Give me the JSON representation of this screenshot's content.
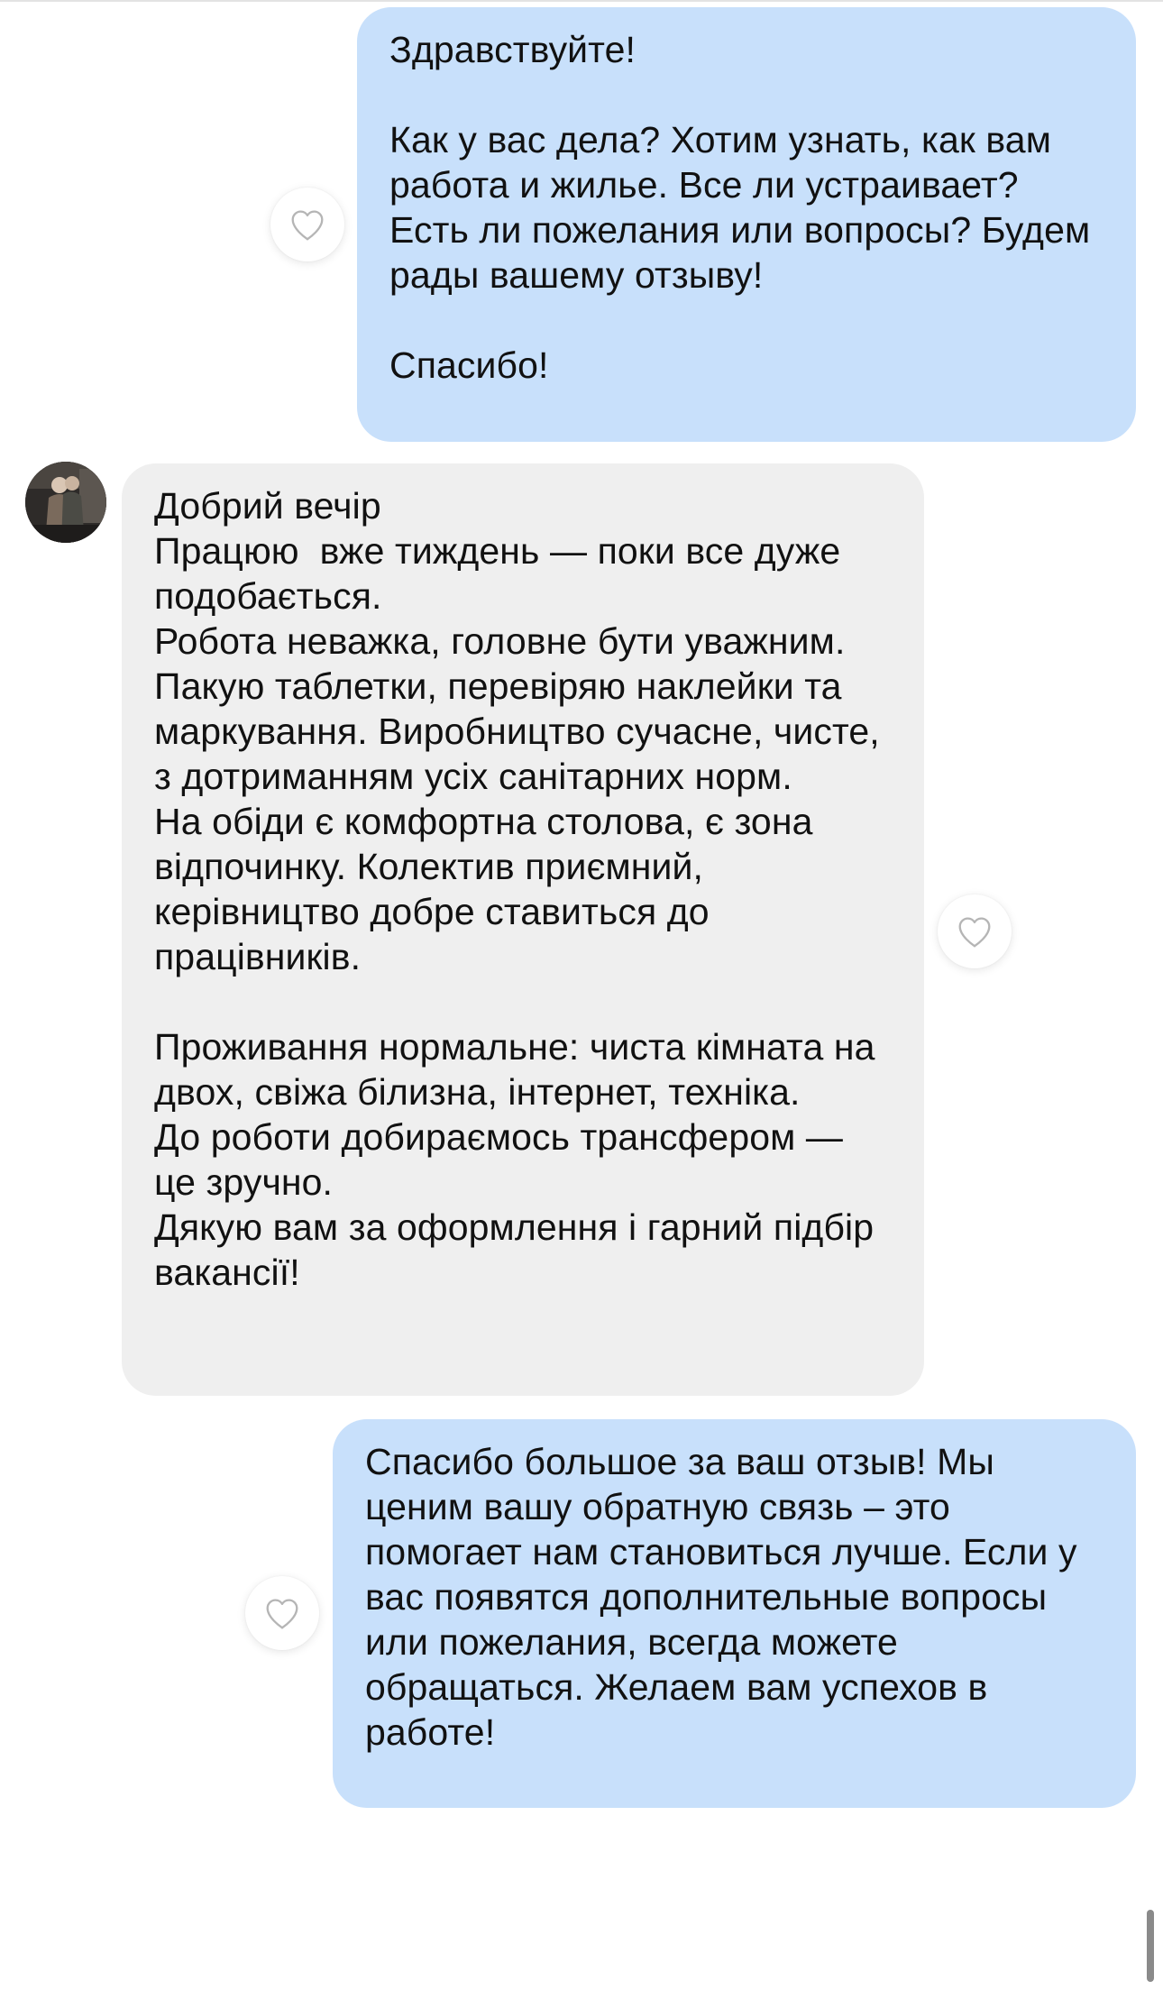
{
  "conversation": {
    "messages": [
      {
        "direction": "outgoing",
        "text": "Здравствуйте!\n\nКак у вас дела? Хотим узнать, как вам работа и жилье. Все ли устраивает? Есть ли пожелания или вопросы? Будем рады вашему отзыву!\n\nСпасибо!"
      },
      {
        "direction": "incoming",
        "text": "Добрий вечір\nПрацюю  вже тиждень — поки все дуже подобається.\nРобота неважка, головне бути уважним. Пакую таблетки, перевіряю наклейки та маркування. Виробництво сучасне, чисте, з дотриманням усіх санітарних норм.\nНа обіди є комфортна столова, є зона відпочинку. Колектив приємний, керівництво добре ставиться до працівників.\n\nПроживання нормальне: чиста кімната на двох, свіжа білизна, інтернет, техніка.\nДо роботи добираємось трансфером — це зручно.\nДякую вам за оформлення і гарний підбір вакансії!"
      },
      {
        "direction": "outgoing",
        "text": "Спасибо большое за ваш отзыв! Мы ценим вашу обратную связь – это помогает нам становиться лучше. Если у вас появятся дополнительные вопросы или пожелания, всегда можете обращаться. Желаем вам успехов в работе!"
      }
    ],
    "like_icon": "heart-outline-icon",
    "avatar_icon": "user-avatar-photo"
  },
  "colors": {
    "outgoing_bubble": "#c8e0fb",
    "incoming_bubble": "#efefef",
    "heart_outline": "#b5b5b5"
  }
}
